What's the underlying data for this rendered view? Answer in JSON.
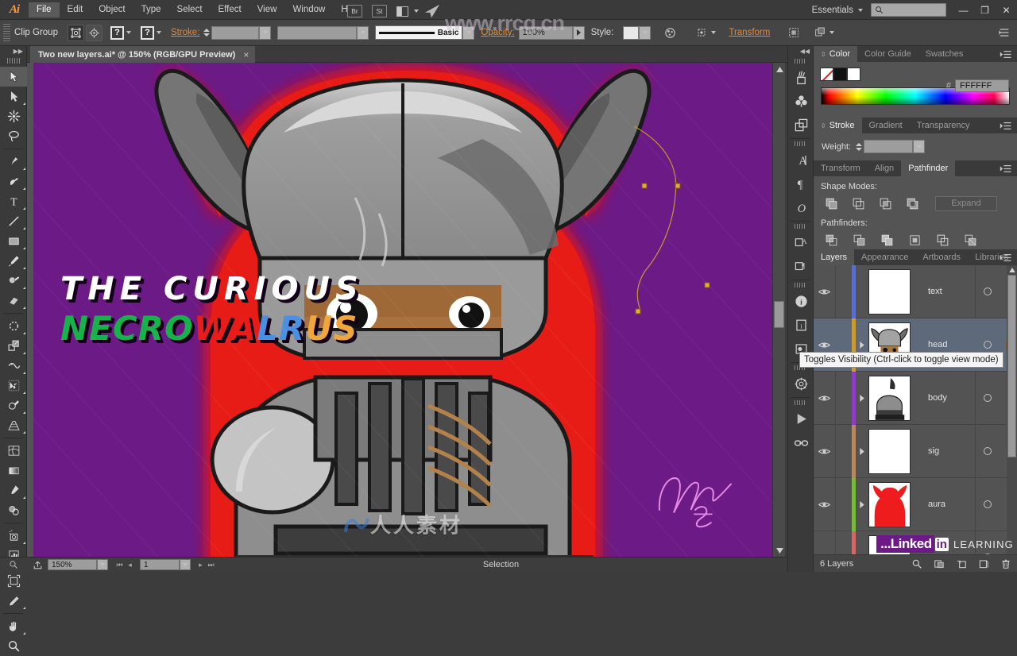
{
  "app": {
    "logo": "Ai",
    "workspace": "Essentials",
    "search_placeholder": "",
    "watermark_site": "www.rrcg.cn",
    "watermark_cn": "人人素材",
    "linkedin": {
      "brand": "...Linked",
      "in": "in",
      "learning": "LEARNING"
    }
  },
  "menu": {
    "items": [
      {
        "label": "File",
        "active": true
      },
      {
        "label": "Edit",
        "active": false
      },
      {
        "label": "Object",
        "active": false
      },
      {
        "label": "Type",
        "active": false
      },
      {
        "label": "Select",
        "active": false
      },
      {
        "label": "Effect",
        "active": false
      },
      {
        "label": "View",
        "active": false
      },
      {
        "label": "Window",
        "active": false
      },
      {
        "label": "Help",
        "active": false
      }
    ],
    "bridge": "Br",
    "stock": "St"
  },
  "window_controls": {
    "minimize": "—",
    "restore": "❐",
    "close": "✕"
  },
  "control_bar": {
    "selection_label": "Clip Group",
    "fill_question": "?",
    "stroke_question": "?",
    "stroke_label": "Stroke:",
    "stroke_profile": "Basic",
    "opacity_label": "Opacity:",
    "opacity_value": "100%",
    "style_label": "Style:",
    "transform_label": "Transform"
  },
  "document": {
    "tab_title": "Two new layers.ai* @ 150% (RGB/GPU Preview)",
    "close_glyph": "×"
  },
  "artwork": {
    "title_line1": "THE CURIOUS",
    "title_line2_parts": [
      {
        "text": "NECRO",
        "color": "#16b34a"
      },
      {
        "text": "WA",
        "color": "#e81c18"
      },
      {
        "text": "L",
        "color": "#4a90e2"
      },
      {
        "text": "R",
        "color": "#4a90e2"
      },
      {
        "text": "US",
        "color": "#f0a63c"
      }
    ],
    "background_color": "#6b1a86",
    "aura_color": "#e81c18",
    "signature_color": "#e48ae0"
  },
  "toolbar": {
    "tools": [
      {
        "name": "selection-tool",
        "selected": true,
        "corner": false
      },
      {
        "name": "direct-selection-tool",
        "selected": false,
        "corner": true
      },
      {
        "name": "magic-wand-tool",
        "selected": false,
        "corner": false
      },
      {
        "name": "lasso-tool",
        "selected": false,
        "corner": false
      },
      {
        "name": "pen-tool",
        "selected": false,
        "corner": true
      },
      {
        "name": "curvature-tool",
        "selected": false,
        "corner": true
      },
      {
        "name": "type-tool",
        "selected": false,
        "corner": true
      },
      {
        "name": "line-segment-tool",
        "selected": false,
        "corner": true
      },
      {
        "name": "rectangle-tool",
        "selected": false,
        "corner": true
      },
      {
        "name": "paintbrush-tool",
        "selected": false,
        "corner": true
      },
      {
        "name": "shaper-tool",
        "selected": false,
        "corner": true
      },
      {
        "name": "eraser-tool",
        "selected": false,
        "corner": true
      },
      {
        "name": "rotate-tool",
        "selected": false,
        "corner": true
      },
      {
        "name": "scale-tool",
        "selected": false,
        "corner": true
      },
      {
        "name": "width-tool",
        "selected": false,
        "corner": true
      },
      {
        "name": "free-transform-tool",
        "selected": false,
        "corner": true
      },
      {
        "name": "shape-builder-tool",
        "selected": false,
        "corner": true
      },
      {
        "name": "perspective-grid-tool",
        "selected": false,
        "corner": true
      },
      {
        "name": "mesh-tool",
        "selected": false,
        "corner": false
      },
      {
        "name": "gradient-tool",
        "selected": false,
        "corner": false
      },
      {
        "name": "eyedropper-tool",
        "selected": false,
        "corner": true
      },
      {
        "name": "blend-tool",
        "selected": false,
        "corner": false
      },
      {
        "name": "symbol-sprayer-tool",
        "selected": false,
        "corner": true
      },
      {
        "name": "column-graph-tool",
        "selected": false,
        "corner": true
      },
      {
        "name": "artboard-tool",
        "selected": false,
        "corner": false
      },
      {
        "name": "slice-tool",
        "selected": false,
        "corner": true
      },
      {
        "name": "hand-tool",
        "selected": false,
        "corner": true
      },
      {
        "name": "zoom-tool",
        "selected": false,
        "corner": false
      }
    ]
  },
  "icon_rail": {
    "icons": [
      "brushes-icon",
      "symbols-icon",
      "layers-rail-icon",
      "character-icon",
      "paragraph-icon",
      "opentype-icon",
      "character-styles-icon",
      "paragraph-styles-icon",
      "info-icon",
      "attributes-icon",
      "document-info-icon",
      "navigator-icon",
      "actions-icon",
      "links-icon"
    ]
  },
  "color_panel": {
    "tabs": [
      {
        "label": "Color",
        "active": true
      },
      {
        "label": "Color Guide",
        "active": false
      },
      {
        "label": "Swatches",
        "active": false
      }
    ],
    "hash": "#",
    "hex_value": "FFFFFF"
  },
  "stroke_panel": {
    "tabs": [
      {
        "label": "Stroke",
        "active": true
      },
      {
        "label": "Gradient",
        "active": false
      },
      {
        "label": "Transparency",
        "active": false
      }
    ],
    "weight_label": "Weight:",
    "weight_value": ""
  },
  "pathfinder_panel": {
    "tabs": [
      {
        "label": "Transform",
        "active": false
      },
      {
        "label": "Align",
        "active": false
      },
      {
        "label": "Pathfinder",
        "active": true
      }
    ],
    "shape_modes_label": "Shape Modes:",
    "pathfinders_label": "Pathfinders:",
    "expand_label": "Expand",
    "shape_modes": [
      "unite-icon",
      "minus-front-icon",
      "intersect-icon",
      "exclude-icon"
    ],
    "pathfinders": [
      "divide-icon",
      "trim-icon",
      "merge-icon",
      "crop-icon",
      "outline-icon",
      "minus-back-icon"
    ]
  },
  "layers_panel": {
    "tabs": [
      {
        "label": "Layers",
        "active": true
      },
      {
        "label": "Appearance",
        "active": false
      },
      {
        "label": "Artboards",
        "active": false
      },
      {
        "label": "Libraries",
        "active": false
      }
    ],
    "rows": [
      {
        "name": "text",
        "color": "#5b6ec8",
        "selected": false,
        "has_arrow": false,
        "targeted": false,
        "thumb": "blank"
      },
      {
        "name": "head",
        "color": "#c99a35",
        "selected": true,
        "has_arrow": true,
        "targeted": true,
        "thumb": "head"
      },
      {
        "name": "body",
        "color": "#8a3fc0",
        "selected": false,
        "has_arrow": true,
        "targeted": false,
        "thumb": "body"
      },
      {
        "name": "sig",
        "color": "#b58a62",
        "selected": false,
        "has_arrow": true,
        "targeted": false,
        "thumb": "blank"
      },
      {
        "name": "aura",
        "color": "#79b83c",
        "selected": false,
        "has_arrow": true,
        "targeted": false,
        "thumb": "aura"
      },
      {
        "name": "",
        "color": "#d06a6a",
        "selected": false,
        "has_arrow": true,
        "targeted": false,
        "thumb": "blank"
      }
    ],
    "footer_count": "6 Layers",
    "footer_icons": [
      "locate-object-icon",
      "make-mask-icon",
      "create-sublayer-icon",
      "new-layer-icon",
      "delete-layer-icon"
    ]
  },
  "tooltip": {
    "text": "Toggles Visibility (Ctrl-click to toggle view mode)"
  },
  "status_bar": {
    "zoom_value": "150%",
    "page_value": "1",
    "status_text": "Selection",
    "first_glyph": "⏮",
    "prev_glyph": "◂",
    "next_glyph": "▸",
    "last_glyph": "⏭"
  }
}
